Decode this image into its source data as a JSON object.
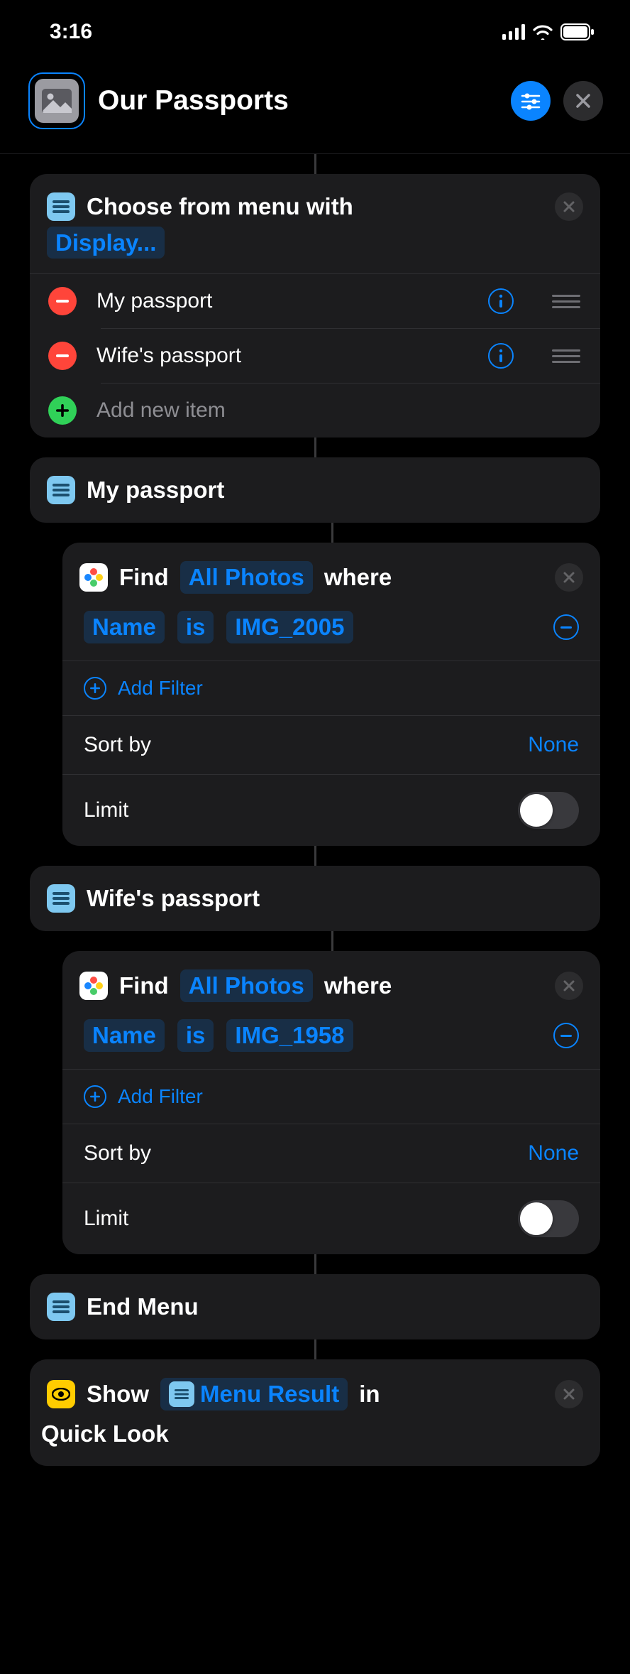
{
  "status": {
    "time": "3:16"
  },
  "header": {
    "title": "Our Passports"
  },
  "menuAction": {
    "prefix": "Choose from menu with",
    "prompt": "Display...",
    "items": [
      {
        "label": "My passport"
      },
      {
        "label": "Wife's passport"
      }
    ],
    "addNew": "Add new item"
  },
  "case1": {
    "label": "My passport",
    "findVerb": "Find",
    "source": "All Photos",
    "whereWord": "where",
    "filterField": "Name",
    "filterOp": "is",
    "filterValue": "IMG_2005",
    "addFilter": "Add Filter",
    "sortLabel": "Sort by",
    "sortValue": "None",
    "limitLabel": "Limit",
    "limitOn": false
  },
  "case2": {
    "label": "Wife's passport",
    "findVerb": "Find",
    "source": "All Photos",
    "whereWord": "where",
    "filterField": "Name",
    "filterOp": "is",
    "filterValue": "IMG_1958",
    "addFilter": "Add Filter",
    "sortLabel": "Sort by",
    "sortValue": "None",
    "limitLabel": "Limit",
    "limitOn": false
  },
  "endMenu": {
    "label": "End Menu"
  },
  "showAction": {
    "verb": "Show",
    "variable": "Menu Result",
    "inWord": "in",
    "app": "Quick Look"
  }
}
